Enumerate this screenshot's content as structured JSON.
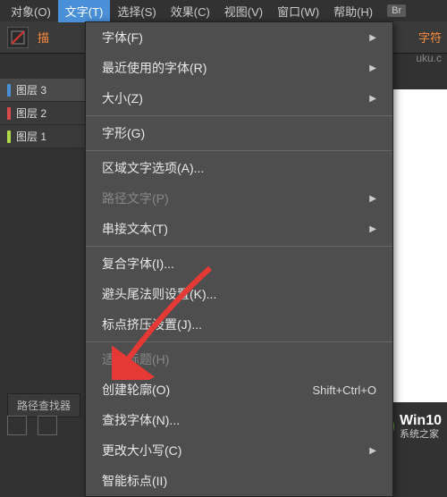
{
  "menubar": {
    "items": [
      {
        "label": "对象(O)"
      },
      {
        "label": "文字(T)"
      },
      {
        "label": "选择(S)"
      },
      {
        "label": "效果(C)"
      },
      {
        "label": "视图(V)"
      },
      {
        "label": "窗口(W)"
      },
      {
        "label": "帮助(H)"
      }
    ],
    "badge": "Br"
  },
  "toolbar": {
    "orange_left": "描",
    "orange_right": "字符",
    "right_text": "uku.c"
  },
  "layers": [
    {
      "label": "图层 3",
      "color": "#4a90d9",
      "selected": true
    },
    {
      "label": "图层 2",
      "color": "#d94a4a",
      "selected": false
    },
    {
      "label": "图层 1",
      "color": "#b0d94a",
      "selected": false
    }
  ],
  "dropdown": [
    {
      "label": "字体(F)",
      "type": "submenu"
    },
    {
      "label": "最近使用的字体(R)",
      "type": "submenu"
    },
    {
      "label": "大小(Z)",
      "type": "submenu"
    },
    {
      "type": "separator"
    },
    {
      "label": "字形(G)",
      "type": "item"
    },
    {
      "type": "separator"
    },
    {
      "label": "区域文字选项(A)...",
      "type": "item"
    },
    {
      "label": "路径文字(P)",
      "type": "submenu",
      "disabled": true
    },
    {
      "label": "串接文本(T)",
      "type": "submenu"
    },
    {
      "type": "separator"
    },
    {
      "label": "复合字体(I)...",
      "type": "item"
    },
    {
      "label": "避头尾法则设置(K)...",
      "type": "item"
    },
    {
      "label": "标点挤压设置(J)...",
      "type": "item"
    },
    {
      "type": "separator"
    },
    {
      "label": "适合标题(H)",
      "type": "item",
      "disabled": true
    },
    {
      "label": "创建轮廓(O)",
      "type": "item",
      "shortcut": "Shift+Ctrl+O"
    },
    {
      "label": "查找字体(N)...",
      "type": "item"
    },
    {
      "label": "更改大小写(C)",
      "type": "submenu"
    },
    {
      "label": "智能标点(II)",
      "type": "item"
    }
  ],
  "pathfinder": {
    "label": "路径查找器"
  },
  "watermark": {
    "brand": "Win10",
    "subtitle": "系统之家"
  }
}
